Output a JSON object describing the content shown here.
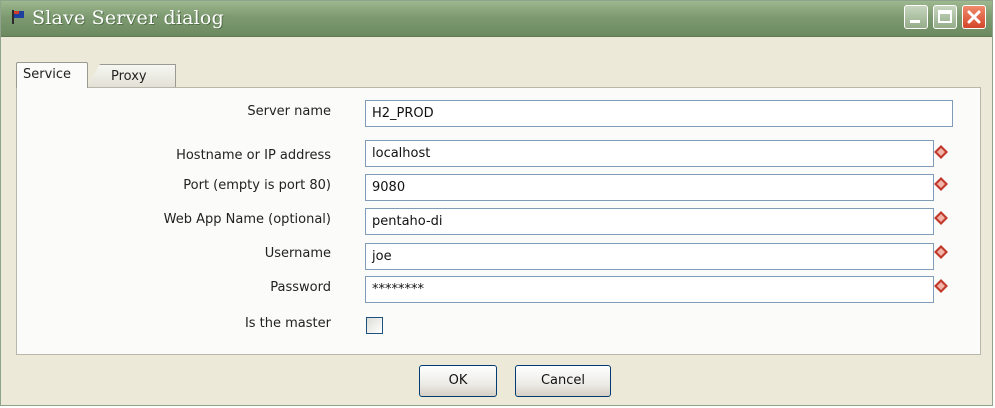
{
  "window": {
    "title": "Slave Server dialog"
  },
  "tabs": [
    {
      "label": "Service",
      "active": true
    },
    {
      "label": "Proxy",
      "active": false
    }
  ],
  "form": {
    "server_name": {
      "label": "Server name",
      "value": "H2_PROD"
    },
    "hostname": {
      "label": "Hostname or IP address",
      "value": "localhost"
    },
    "port": {
      "label": "Port (empty is port 80)",
      "value": "9080"
    },
    "webapp": {
      "label": "Web App Name (optional)",
      "value": "pentaho-di"
    },
    "username": {
      "label": "Username",
      "value": "joe"
    },
    "password": {
      "label": "Password",
      "value": "********"
    },
    "is_master": {
      "label": "Is the master",
      "checked": false
    }
  },
  "buttons": {
    "ok": "OK",
    "cancel": "Cancel"
  },
  "colors": {
    "titlebar": "#7d9a70",
    "diamond": "#c0392b",
    "field_border": "#7f9db9"
  },
  "icons": {
    "app": "flag-icon",
    "variable": "variable-diamond-icon"
  }
}
